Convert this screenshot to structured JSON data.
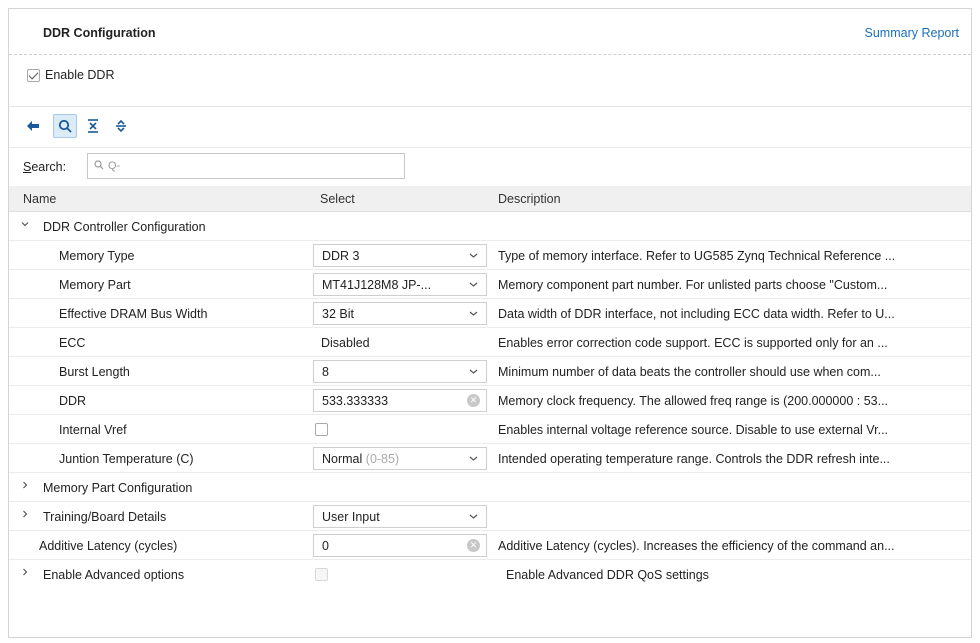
{
  "header": {
    "title": "DDR Configuration",
    "summary_link": "Summary Report"
  },
  "enable_ddr": {
    "label": "Enable DDR",
    "checked": true
  },
  "toolbar": {
    "buttons": [
      "back-arrow-icon",
      "search-icon",
      "collapse-all-icon",
      "expand-all-icon"
    ]
  },
  "search": {
    "label_prefix": "S",
    "label_rest": "earch:",
    "placeholder": "Q-"
  },
  "columns": {
    "name": "Name",
    "select": "Select",
    "description": "Description"
  },
  "rows": [
    {
      "name": "DDR Controller Configuration",
      "kind": "group",
      "expanded": true
    },
    {
      "name": "Memory Type",
      "select": "DDR 3",
      "widget": "dropdown",
      "description": "Type of memory interface. Refer to UG585 Zynq Technical Reference ..."
    },
    {
      "name": "Memory Part",
      "select": "MT41J128M8 JP-...",
      "widget": "dropdown",
      "description": "Memory component part number. For unlisted parts choose \"Custom..."
    },
    {
      "name": "Effective DRAM Bus Width",
      "select": "32 Bit",
      "widget": "dropdown",
      "description": "Data width of DDR interface, not including ECC data width. Refer to U..."
    },
    {
      "name": "ECC",
      "select": "Disabled",
      "widget": "text",
      "description": "Enables error correction code support. ECC is supported only for an ..."
    },
    {
      "name": "Burst Length",
      "select": "8",
      "widget": "dropdown",
      "description": "Minimum number of data beats the controller should use when com..."
    },
    {
      "name": "DDR",
      "select": "533.333333",
      "widget": "textfield",
      "description": "Memory clock frequency. The allowed freq range is (200.000000 : 53..."
    },
    {
      "name": "Internal Vref",
      "select": "",
      "widget": "checkbox",
      "description": "Enables internal voltage reference source. Disable to use external Vr..."
    },
    {
      "name": "Juntion Temperature (C)",
      "select": "Normal",
      "select_extra": "(0-85)",
      "widget": "dropdown",
      "description": "Intended operating temperature range. Controls the DDR refresh inte..."
    },
    {
      "name": "Memory Part Configuration",
      "kind": "group",
      "expanded": false
    },
    {
      "name": "Training/Board Details",
      "select": "User Input",
      "widget": "dropdown",
      "kind": "group",
      "expanded": false,
      "description": ""
    },
    {
      "name": "Additive Latency (cycles)",
      "select": "0",
      "widget": "textfield",
      "kind": "top",
      "description": "Additive Latency (cycles). Increases the efficiency of the command an..."
    },
    {
      "name": "Enable Advanced options",
      "select": "",
      "widget": "checkbox-disabled",
      "kind": "group",
      "expanded": false,
      "description": "Enable Advanced DDR QoS settings"
    }
  ]
}
